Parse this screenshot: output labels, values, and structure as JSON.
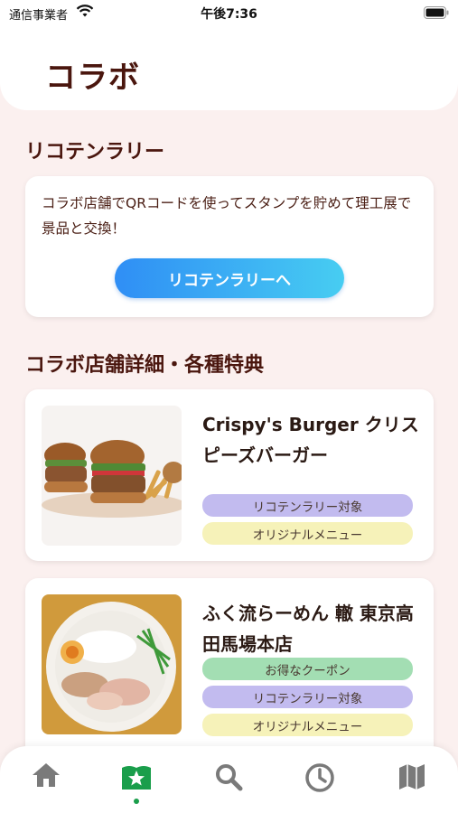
{
  "status_bar": {
    "carrier": "通信事業者",
    "time": "午後7:36"
  },
  "header": {
    "title": "コラボ"
  },
  "rally": {
    "section_title": "リコテンラリー",
    "description": "コラボ店舗でQRコードを使ってスタンプを貯めて理工展で景品と交換！",
    "button_label": "リコテンラリーへ"
  },
  "shops_section": {
    "title": "コラボ店舗詳細・各種特典",
    "shops": [
      {
        "name": "Crispy's Burger クリスピーズバーガー",
        "tags": [
          "リコテンラリー対象",
          "オリジナルメニュー"
        ]
      },
      {
        "name": "ふく流らーめん 轍 東京高田馬場本店",
        "tags": [
          "お得なクーポン",
          "リコテンラリー対象",
          "オリジナルメニュー"
        ]
      }
    ]
  },
  "tab_bar": {
    "items": [
      {
        "icon": "home-icon",
        "active": false
      },
      {
        "icon": "star-badge-icon",
        "active": true
      },
      {
        "icon": "search-icon",
        "active": false
      },
      {
        "icon": "clock-icon",
        "active": false
      },
      {
        "icon": "map-icon",
        "active": false
      }
    ],
    "active_color": "#1a9e4b",
    "inactive_color": "#7a7a7a"
  }
}
